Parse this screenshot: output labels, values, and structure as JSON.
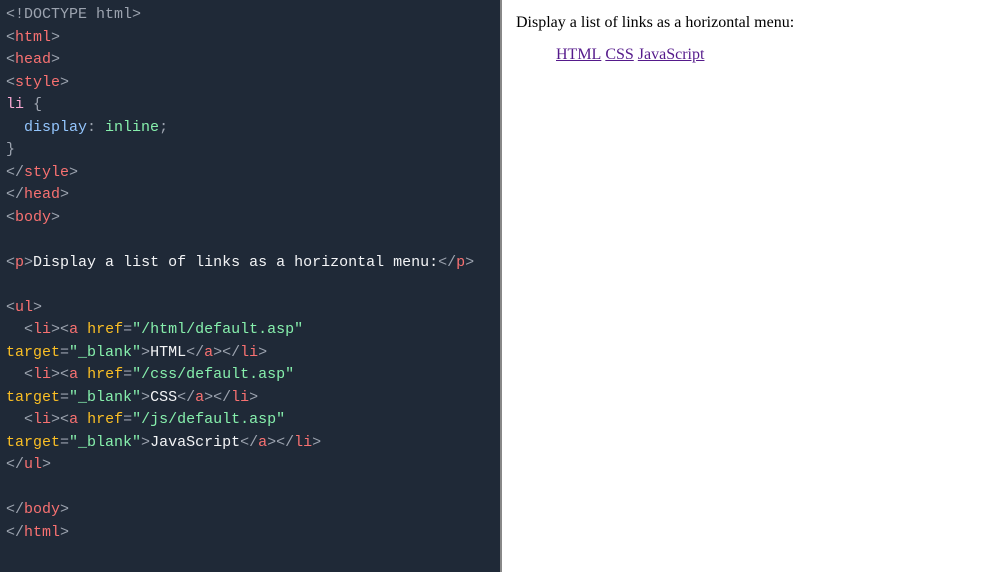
{
  "editor": {
    "doctype": "<!DOCTYPE html>",
    "tag_html_open": "html",
    "tag_head_open": "head",
    "tag_style_open": "style",
    "css_selector": "li",
    "css_brace_open": " {",
    "css_prop": "display",
    "css_colon": ": ",
    "css_value": "inline",
    "css_semi": ";",
    "css_brace_close": "}",
    "tag_style_close": "style",
    "tag_head_close": "head",
    "tag_body_open": "body",
    "tag_p_open": "p",
    "p_text": "Display a list of links as a horizontal menu:",
    "tag_p_close": "p",
    "tag_ul_open": "ul",
    "tag_li": "li",
    "tag_a": "a",
    "attr_href": "href",
    "attr_target": "target",
    "href1": "\"/html/default.asp\"",
    "href2": "\"/css/default.asp\"",
    "href3": "\"/js/default.asp\"",
    "target_blank": "\"_blank\"",
    "link1_text": "HTML",
    "link2_text": "CSS",
    "link3_text": "JavaScript",
    "tag_ul_close": "ul",
    "tag_body_close": "body",
    "tag_html_close": "html"
  },
  "preview": {
    "paragraph": "Display a list of links as a horizontal menu:",
    "links": {
      "0": "HTML",
      "1": "CSS",
      "2": "JavaScript"
    }
  }
}
